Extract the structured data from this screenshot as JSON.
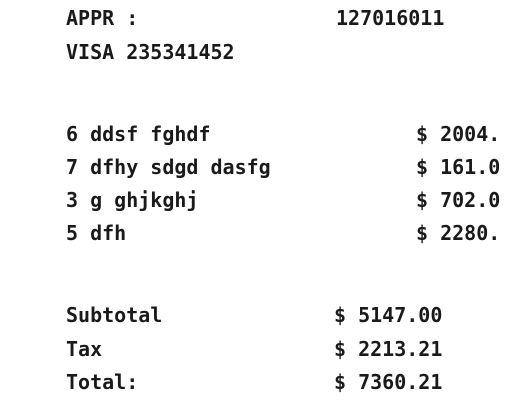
{
  "header": {
    "appr_label": "APPR :",
    "appr_value": "127016011",
    "card_line": "VISA 235341452"
  },
  "items": [
    {
      "qty": "6",
      "name": "ddsf fghdf",
      "price": "$ 2004."
    },
    {
      "qty": "7",
      "name": "dfhy sdgd dasfg",
      "price": "$ 161.0"
    },
    {
      "qty": "3",
      "name": "g ghjkghj",
      "price": "$ 702.0"
    },
    {
      "qty": "5",
      "name": "dfh",
      "price": "$ 2280."
    }
  ],
  "totals": {
    "subtotal_label": "Subtotal",
    "subtotal_value": "$ 5147.00",
    "tax_label": "Tax",
    "tax_value": "$ 2213.21",
    "total_label": "Total:",
    "total_value": "$ 7360.21"
  }
}
